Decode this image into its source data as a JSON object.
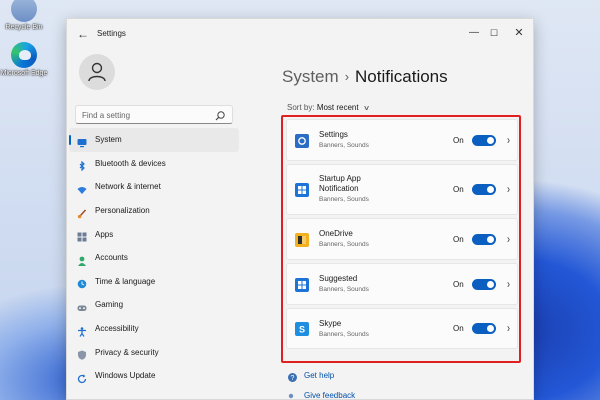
{
  "desktop": {
    "icons": [
      {
        "label": "Recycle Bin",
        "icon": "recycle-bin-icon"
      },
      {
        "label": "Microsoft Edge",
        "icon": "edge-icon"
      }
    ]
  },
  "window": {
    "title": "Settings",
    "controls": {
      "minimize": "—",
      "maximize": "☐",
      "close": "✕"
    }
  },
  "sidebar": {
    "search_placeholder": "Find a setting",
    "items": [
      {
        "label": "System",
        "icon": "system-icon",
        "active": true
      },
      {
        "label": "Bluetooth & devices",
        "icon": "bluetooth-icon"
      },
      {
        "label": "Network & internet",
        "icon": "wifi-icon"
      },
      {
        "label": "Personalization",
        "icon": "brush-icon"
      },
      {
        "label": "Apps",
        "icon": "apps-icon"
      },
      {
        "label": "Accounts",
        "icon": "accounts-icon"
      },
      {
        "label": "Time & language",
        "icon": "globe-clock-icon"
      },
      {
        "label": "Gaming",
        "icon": "gaming-icon"
      },
      {
        "label": "Accessibility",
        "icon": "accessibility-icon"
      },
      {
        "label": "Privacy & security",
        "icon": "shield-icon"
      },
      {
        "label": "Windows Update",
        "icon": "update-icon"
      }
    ]
  },
  "main": {
    "breadcrumb_parent": "System",
    "breadcrumb_sep": "›",
    "breadcrumb_current": "Notifications",
    "sort_label": "Sort by:",
    "sort_value": "Most recent",
    "apps": [
      {
        "name": "Settings",
        "sub": "Banners, Sounds",
        "state": "On",
        "enabled": true,
        "icon": "settings-app-icon",
        "color": "#2b6cc4"
      },
      {
        "name": "Startup App",
        "name2": "Notification",
        "sub": "Banners, Sounds",
        "state": "On",
        "enabled": true,
        "icon": "startup-app-icon",
        "color": "#1e73d6"
      },
      {
        "name": "OneDrive",
        "sub": "Banners, Sounds",
        "state": "On",
        "enabled": true,
        "icon": "onedrive-icon",
        "color": "#f2b01e"
      },
      {
        "name": "Suggested",
        "sub": "Banners, Sounds",
        "state": "On",
        "enabled": true,
        "icon": "suggested-icon",
        "color": "#1e73d6"
      },
      {
        "name": "Skype",
        "sub": "Banners, Sounds",
        "state": "On",
        "enabled": true,
        "icon": "skype-icon",
        "color": "#1e8fe0"
      }
    ],
    "help": [
      {
        "label": "Get help",
        "icon": "help-icon"
      },
      {
        "label": "Give feedback",
        "icon": "feedback-icon"
      }
    ]
  },
  "colors": {
    "accent": "#0a5fc0",
    "highlight_frame": "#e02020"
  }
}
